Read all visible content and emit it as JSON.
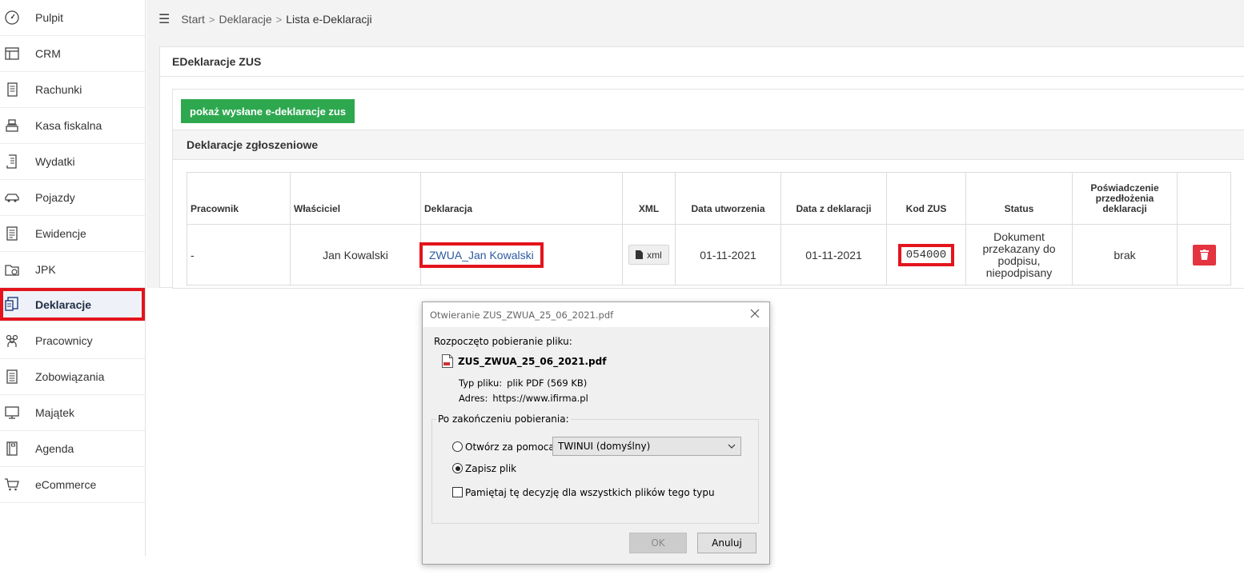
{
  "sidebar": {
    "items": [
      {
        "label": "Pulpit",
        "icon": "dashboard-icon"
      },
      {
        "label": "CRM",
        "icon": "crm-icon"
      },
      {
        "label": "Rachunki",
        "icon": "invoice-icon"
      },
      {
        "label": "Kasa fiskalna",
        "icon": "cash-register-icon"
      },
      {
        "label": "Wydatki",
        "icon": "expenses-icon"
      },
      {
        "label": "Pojazdy",
        "icon": "car-icon"
      },
      {
        "label": "Ewidencje",
        "icon": "records-icon"
      },
      {
        "label": "JPK",
        "icon": "jpk-icon"
      },
      {
        "label": "Deklaracje",
        "icon": "declarations-icon"
      },
      {
        "label": "Pracownicy",
        "icon": "employees-icon"
      },
      {
        "label": "Zobowiązania",
        "icon": "liabilities-icon"
      },
      {
        "label": "Majątek",
        "icon": "assets-icon"
      },
      {
        "label": "Agenda",
        "icon": "agenda-icon"
      },
      {
        "label": "eCommerce",
        "icon": "cart-icon"
      }
    ],
    "active_label": "Deklaracje"
  },
  "breadcrumb": {
    "items": [
      "Start",
      "Deklaracje",
      "Lista e-Deklaracji"
    ]
  },
  "panel": {
    "title": "EDeklaracje ZUS",
    "show_sent_button": "pokaż wysłane e-deklaracje zus",
    "section_title": "Deklaracje zgłoszeniowe"
  },
  "table": {
    "headers": {
      "employee": "Pracownik",
      "owner": "Właściciel",
      "declaration": "Deklaracja",
      "xml": "XML",
      "created": "Data utworzenia",
      "decl_date": "Data z deklaracji",
      "zus_code": "Kod ZUS",
      "status": "Status",
      "certificate": "Poświadczenie przedłożenia deklaracji"
    },
    "rows": [
      {
        "employee": "-",
        "owner": "Jan Kowalski",
        "declaration": "ZWUA_Jan Kowalski",
        "xml": "xml",
        "created": "01-11-2021",
        "decl_date": "01-11-2021",
        "zus_code": "054000",
        "status": "Dokument przekazany do podpisu, niepodpisany",
        "certificate": "brak"
      }
    ]
  },
  "dialog": {
    "title": "Otwieranie ZUS_ZWUA_25_06_2021.pdf",
    "heading": "Rozpoczęto pobieranie pliku:",
    "filename": "ZUS_ZWUA_25_06_2021.pdf",
    "type_label": "Typ pliku:",
    "type_value": "plik PDF (569 KB)",
    "address_label": "Adres:",
    "address_value": "https://www.ifirma.pl",
    "group_label": "Po zakończeniu pobierania:",
    "open_with_label": "Otwórz za pomocą",
    "open_with_app": "TWINUI (domyślny)",
    "save_label": "Zapisz plik",
    "remember_label": "Pamiętaj tę decyzję dla wszystkich plików tego typu",
    "ok_label": "OK",
    "cancel_label": "Anuluj",
    "selected_option": "save"
  },
  "colors": {
    "green": "#2ea84f",
    "highlight_red": "#e3141c",
    "link_blue": "#2d5aa0",
    "delete_red": "#e3343f"
  }
}
